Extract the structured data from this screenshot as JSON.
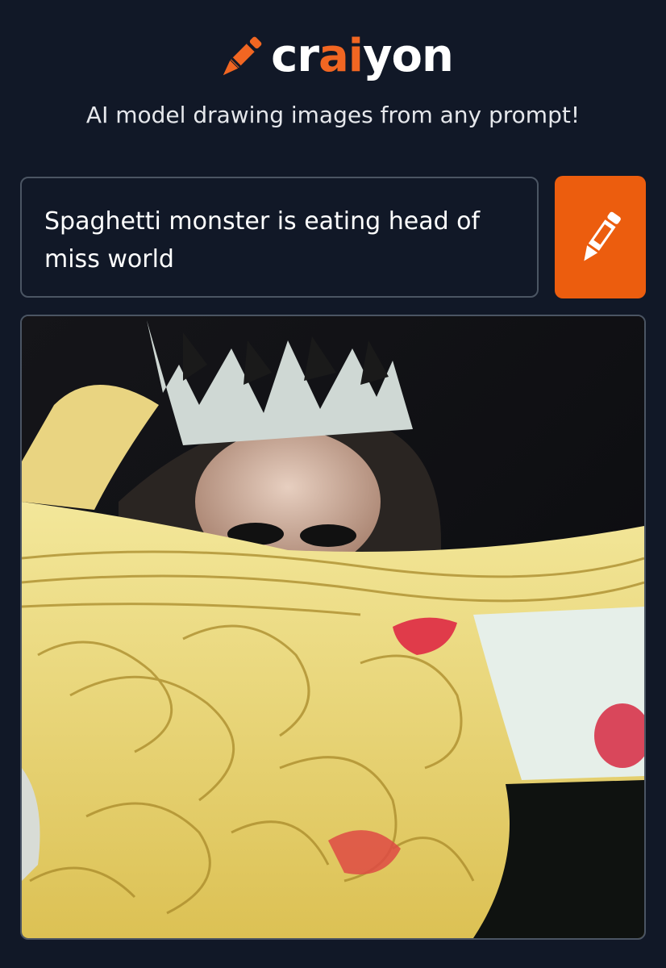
{
  "header": {
    "logo_text_prefix": "cr",
    "logo_text_accent": "ai",
    "logo_text_suffix": "yon",
    "logo_icon": "crayon-icon",
    "tagline": "AI model drawing images from any prompt!"
  },
  "prompt": {
    "value": "Spaghetti monster is eating head of miss world"
  },
  "draw_button": {
    "icon": "crayon-icon"
  },
  "result": {
    "image_alt": "Generated image: woman with crown partially covered by spaghetti"
  },
  "colors": {
    "background": "#111827",
    "accent": "#f16622",
    "button": "#ec5d0e",
    "border": "#4b5563",
    "text": "#ffffff"
  }
}
